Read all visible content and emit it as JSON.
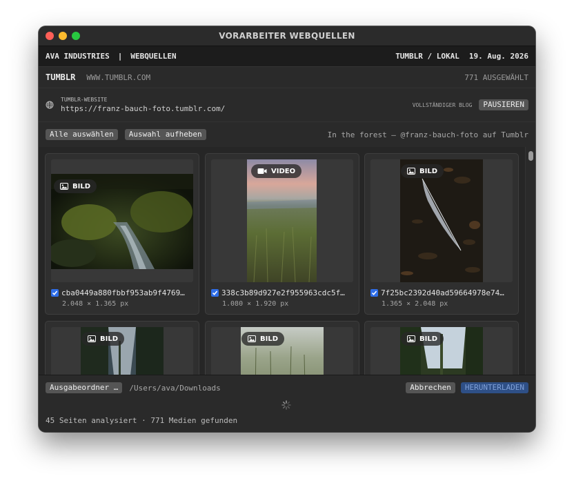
{
  "window": {
    "title": "VORARBEITER WEBQUELLEN"
  },
  "header": {
    "company": "AVA INDUSTRIES",
    "separator": "|",
    "section": "WEBQUELLEN",
    "source": "TUMBLR / LOKAL",
    "date": "19. Aug. 2026"
  },
  "source_bar": {
    "name": "TUMBLR",
    "url": "WWW.TUMBLR.COM",
    "selected": "771 AUSGEWÄHLT"
  },
  "site": {
    "label": "TUMBLR-WEBSITE",
    "url": "https://franz-bauch-foto.tumblr.com/",
    "mode": "VOLLSTÄNDIGER BLOG",
    "pause_label": "PAUSIEREN"
  },
  "selection": {
    "select_all": "Alle auswählen",
    "deselect": "Auswahl aufheben",
    "caption": "In the forest — @franz-bauch-foto auf Tumblr"
  },
  "media": [
    {
      "type": "BILD",
      "icon": "image-icon",
      "name": "cba0449a880fbbf953ab9f4769…",
      "dims": "2.048 × 1.365 px",
      "checked": true
    },
    {
      "type": "VIDEO",
      "icon": "video-camera-icon",
      "name": "338c3b89d927e2f955963cdc5f…",
      "dims": "1.080 × 1.920 px",
      "checked": true
    },
    {
      "type": "BILD",
      "icon": "image-icon",
      "name": "7f25bc2392d40ad59664978e74…",
      "dims": "1.365 × 2.048 px",
      "checked": true
    },
    {
      "type": "BILD",
      "icon": "image-icon"
    },
    {
      "type": "BILD",
      "icon": "image-icon"
    },
    {
      "type": "BILD",
      "icon": "image-icon"
    }
  ],
  "footer": {
    "output_button": "Ausgabeordner …",
    "output_path": "/Users/ava/Downloads",
    "cancel": "Abbrechen",
    "download": "HERUNTERLADEN",
    "status": "45 Seiten analysiert · 771 Medien gefunden"
  },
  "colors": {
    "accent": "#2f6ee8",
    "download_button": "#2e4f86",
    "close": "#fe5f57",
    "minimize": "#febc2e",
    "maximize": "#28c840"
  }
}
